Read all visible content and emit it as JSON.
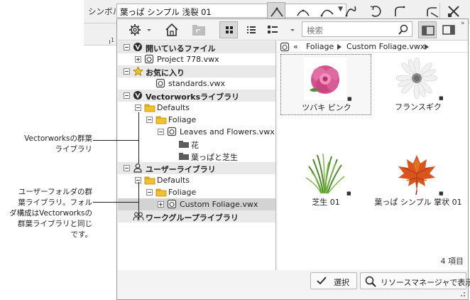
{
  "toolbar": {
    "label": "シンボル",
    "symbol_value": "葉っぱ シンプル 浅裂 01",
    "tools": [
      "line-tool-icon",
      "arc-tool-icon",
      "arc-alt-tool-icon",
      "curve-tool-icon",
      "rotate-tool-icon",
      "corner-tool-icon",
      "fillet-tool-icon",
      "clip-tool-icon"
    ]
  },
  "ruler": {
    "mark": "1"
  },
  "panel": {
    "search_placeholder": "検索",
    "breadcrumb": {
      "back": "«",
      "items": [
        "Foliage",
        "Custom Foliage.vwx"
      ]
    },
    "tree": [
      {
        "label": "開いているファイル",
        "header": true,
        "toggle": "minus",
        "icon": "vectorworks-icon",
        "indent": 0
      },
      {
        "label": "Project 778.vwx",
        "toggle": "plus",
        "icon": "file-icon",
        "indent": 1
      },
      {
        "label": "お気に入り",
        "header": true,
        "toggle": "minus",
        "icon": "star-icon",
        "indent": 0
      },
      {
        "label": "standards.vwx",
        "icon": "file-icon",
        "indent": 2
      },
      {
        "label": "Vectorworksライブラリ",
        "header": true,
        "toggle": "minus",
        "icon": "vectorworks-icon",
        "indent": 0
      },
      {
        "label": "Defaults",
        "toggle": "minus",
        "icon": "folder-icon",
        "indent": 1
      },
      {
        "label": "Foliage",
        "toggle": "minus",
        "icon": "folder-icon",
        "indent": 2
      },
      {
        "label": "Leaves and Flowers.vwx",
        "toggle": "minus",
        "icon": "file-icon",
        "indent": 3
      },
      {
        "label": "花",
        "icon": "dark-folder-icon",
        "indent": 4
      },
      {
        "label": "葉っぱと芝生",
        "icon": "dark-folder-icon",
        "indent": 4
      },
      {
        "label": "ユーザーライブラリ",
        "header": true,
        "toggle": "minus",
        "icon": "user-icon",
        "indent": 0
      },
      {
        "label": "Defaults",
        "toggle": "minus",
        "icon": "folder-icon",
        "indent": 1
      },
      {
        "label": "Foliage",
        "toggle": "minus",
        "icon": "folder-icon",
        "indent": 2
      },
      {
        "label": "Custom Foliage.vwx",
        "toggle": "plus",
        "icon": "file-icon",
        "indent": 3,
        "selected": true
      },
      {
        "label": "ワークグループライブラリ",
        "header": true,
        "icon": "workgroup-icon",
        "indent": 0
      }
    ],
    "resources": [
      {
        "label": "ツバキ ピンク",
        "kind": "pink-flower",
        "selected": true
      },
      {
        "label": "フランスギク",
        "kind": "daisy"
      },
      {
        "label": "芝生 01",
        "kind": "grass"
      },
      {
        "label": "葉っぱ シンプル 掌状 01",
        "kind": "maple-leaf"
      }
    ],
    "count": "4 項目",
    "select_button": "選択",
    "manager_button": "リソースマネージャで表示"
  },
  "annotations": {
    "vectorworks_library": "Vectorworksの群葉\nライブラリ",
    "user_folder": "ユーザーフォルダの群\n葉ライブラリ。フォル\nダ構成はVectorworksの\n群葉ライブラリと同じ\nです。"
  },
  "colors": {
    "folder": "#f2c12e",
    "selection": "#d3d3d3",
    "header": "#e9e9e9"
  }
}
